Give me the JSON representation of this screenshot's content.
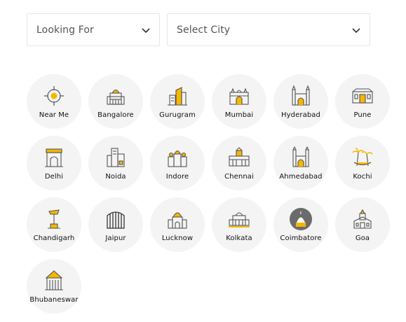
{
  "filters": {
    "looking_for": {
      "label": "Looking For",
      "icon": "chevron-down-icon"
    },
    "city": {
      "label": "Select City",
      "icon": "chevron-down-icon"
    }
  },
  "colors": {
    "accent": "#f5b700",
    "outline": "#555555",
    "circle_bg": "#f4f4f4"
  },
  "cities": [
    {
      "name": "Near Me",
      "icon": "near-me-icon"
    },
    {
      "name": "Bangalore",
      "icon": "bangalore-icon"
    },
    {
      "name": "Gurugram",
      "icon": "gurugram-icon"
    },
    {
      "name": "Mumbai",
      "icon": "mumbai-icon"
    },
    {
      "name": "Hyderabad",
      "icon": "hyderabad-icon"
    },
    {
      "name": "Pune",
      "icon": "pune-icon"
    },
    {
      "name": "Delhi",
      "icon": "delhi-icon"
    },
    {
      "name": "Noida",
      "icon": "noida-icon"
    },
    {
      "name": "Indore",
      "icon": "indore-icon"
    },
    {
      "name": "Chennai",
      "icon": "chennai-icon"
    },
    {
      "name": "Ahmedabad",
      "icon": "ahmedabad-icon"
    },
    {
      "name": "Kochi",
      "icon": "kochi-icon"
    },
    {
      "name": "Chandigarh",
      "icon": "chandigarh-icon"
    },
    {
      "name": "Jaipur",
      "icon": "jaipur-icon"
    },
    {
      "name": "Lucknow",
      "icon": "lucknow-icon"
    },
    {
      "name": "Kolkata",
      "icon": "kolkata-icon"
    },
    {
      "name": "Coimbatore",
      "icon": "coimbatore-icon"
    },
    {
      "name": "Goa",
      "icon": "goa-icon"
    },
    {
      "name": "Bhubaneswar",
      "icon": "bhubaneswar-icon"
    }
  ]
}
